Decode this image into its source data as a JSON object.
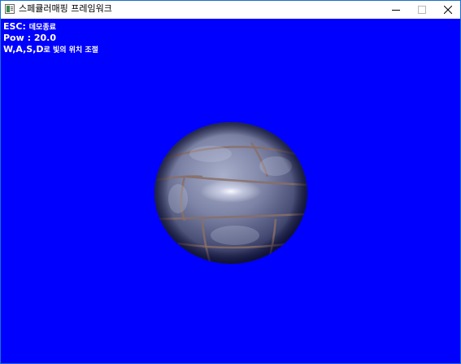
{
  "window": {
    "title": "스페큘러매핑 프레임워크",
    "app_icon": "window-app-icon",
    "controls": {
      "minimize_icon": "minimize-icon",
      "maximize_icon": "maximize-icon",
      "close_icon": "close-icon"
    }
  },
  "overlay": {
    "esc_key": "ESC:",
    "esc_desc": "데모종료",
    "pow_text": "Pow : 20.0",
    "keys": "W,A,S,D",
    "keys_desc": "로 빛의 위치 조절"
  },
  "colors": {
    "background": "#0000ff",
    "text": "#ffffff",
    "window_border": "#1a6fd0"
  }
}
